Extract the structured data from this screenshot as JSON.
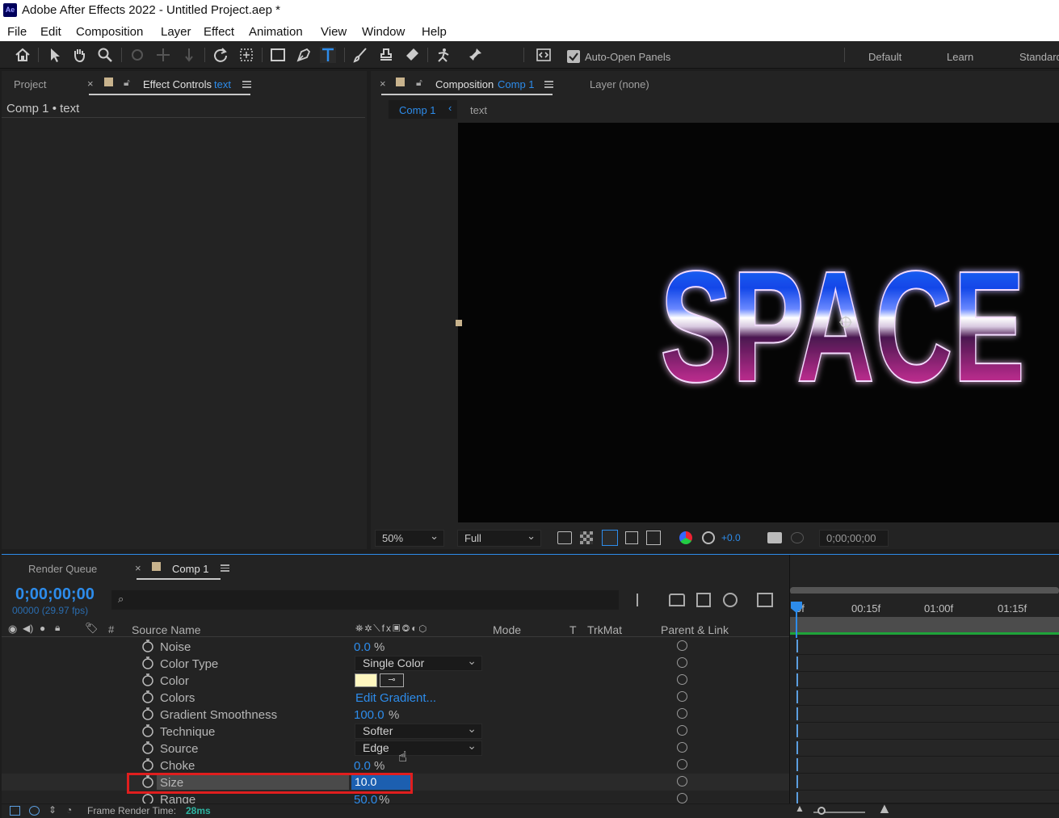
{
  "window": {
    "title": "Adobe After Effects 2022 - Untitled Project.aep *",
    "app_badge": "Ae"
  },
  "menu": [
    "File",
    "Edit",
    "Composition",
    "Layer",
    "Effect",
    "Animation",
    "View",
    "Window",
    "Help"
  ],
  "toolbar": {
    "auto_open_panels": "Auto-Open Panels",
    "auto_open_checked": true,
    "workspaces": [
      "Default",
      "Learn",
      "Standard"
    ]
  },
  "left_panel": {
    "tab_project": "Project",
    "tab_effect_controls": "Effect Controls",
    "tab_effect_target": "text",
    "breadcrumb": "Comp 1 • text"
  },
  "comp_panel": {
    "tab_label": "Composition",
    "tab_target": "Comp 1",
    "layer_tab": "Layer (none)",
    "nav_comp": "Comp 1",
    "nav_layer": "text",
    "viewer_text": "SPACE",
    "zoom": "50%",
    "resolution": "Full",
    "exposure": "+0.0",
    "timecode": "0;00;00;00"
  },
  "timeline": {
    "tab_render_queue": "Render Queue",
    "tab_comp": "Comp 1",
    "current_time": "0;00;00;00",
    "frame_info": "00000 (29.97 fps)",
    "search_placeholder": "",
    "headers": {
      "source_name": "Source Name",
      "mode": "Mode",
      "t": "T",
      "trkmat": "TrkMat",
      "parent_link": "Parent & Link",
      "number": "#"
    },
    "ruler_marks": [
      "0f",
      "00:15f",
      "01:00f",
      "01:15f"
    ],
    "properties": [
      {
        "name": "Noise",
        "value": "0.0",
        "unit": "%",
        "kind": "number"
      },
      {
        "name": "Color Type",
        "value": "Single Color",
        "kind": "dropdown"
      },
      {
        "name": "Color",
        "value": "",
        "kind": "color",
        "swatch": "#fff7c0"
      },
      {
        "name": "Colors",
        "value": "Edit Gradient...",
        "kind": "link"
      },
      {
        "name": "Gradient Smoothness",
        "value": "100.0",
        "unit": "%",
        "kind": "number"
      },
      {
        "name": "Technique",
        "value": "Softer",
        "kind": "dropdown"
      },
      {
        "name": "Source",
        "value": "Edge",
        "kind": "dropdown"
      },
      {
        "name": "Choke",
        "value": "0.0",
        "unit": "%",
        "kind": "number"
      },
      {
        "name": "Size",
        "value": "10.0",
        "kind": "editing",
        "highlighted": true
      },
      {
        "name": "Range",
        "value": "50.0",
        "unit": "%",
        "kind": "number"
      }
    ],
    "frame_render_label": "Frame Render Time:",
    "frame_render_value": "28ms"
  },
  "colors": {
    "accent": "#2d8ceb",
    "highlight_box": "#e01e1e",
    "text_top": "#1a6cff",
    "text_bottom": "#ff3aa0"
  }
}
